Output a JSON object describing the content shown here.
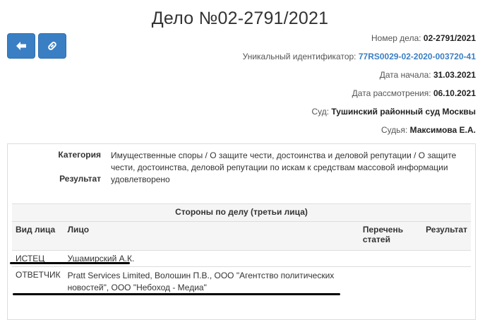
{
  "page": {
    "title": "Дело №02-2791/2021"
  },
  "buttons": {
    "back_icon": "arrow-left-icon",
    "link_icon": "link-icon"
  },
  "case_info": {
    "number_label": "Номер дела:",
    "number_value": "02-2791/2021",
    "uid_label": "Уникальный идентификатор:",
    "uid_value": "77RS0029-02-2020-003720-41",
    "start_label": "Дата начала:",
    "start_value": "31.03.2021",
    "review_label": "Дата рассмотрения:",
    "review_value": "06.10.2021",
    "court_label": "Суд:",
    "court_value": "Тушинский районный суд Москвы",
    "judge_label": "Судья:",
    "judge_value": "Максимова Е.А."
  },
  "details": {
    "category_label": "Категория",
    "category_value": "Имущественные споры / О защите чести, достоинства и деловой репутации / О защите чести, достоинства, деловой репутации по искам к средствам массовой информации",
    "result_label": "Результат",
    "result_value": "удовлетворено"
  },
  "parties": {
    "caption": "Стороны по делу (третьи лица)",
    "columns": [
      "Вид лица",
      "Лицо",
      "Перечень статей",
      "Результат"
    ],
    "rows": [
      {
        "type": "ИСТЕЦ",
        "person": "Ушамирский А.К.",
        "articles": "",
        "result": ""
      },
      {
        "type": "ОТВЕТЧИК",
        "person": "Pratt Services Limited, Волошин П.В., ООО \"Агентство политических новостей\", ООО \"Небоход - Медиа\"",
        "articles": "",
        "result": ""
      }
    ]
  },
  "colors": {
    "button": "#3a7fc4",
    "link": "#3a7fc4",
    "header_bg": "#f5f5f5"
  }
}
